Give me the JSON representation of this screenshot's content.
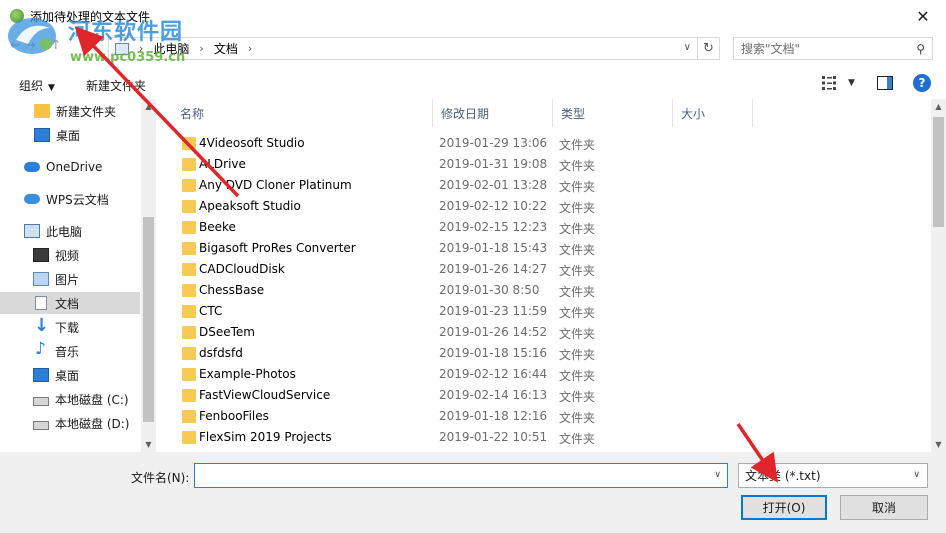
{
  "window": {
    "title": "添加待处理的文本文件",
    "close_glyph": "✕"
  },
  "watermark": {
    "title": "河东软件园",
    "url": "www.pc0359.cn"
  },
  "address": {
    "crumbs": [
      "此电脑",
      "文档"
    ],
    "separator": "›"
  },
  "search": {
    "placeholder": "搜索\"文档\""
  },
  "toolbar": {
    "organize_label": "组织",
    "new_folder_label": "新建文件夹",
    "help_glyph": "?"
  },
  "nav_pane": {
    "items": [
      {
        "label": "新建文件夹",
        "icon": "folder-icon"
      },
      {
        "label": "桌面",
        "icon": "desktop-icon"
      },
      {
        "label": "OneDrive",
        "icon": "onedrive-icon"
      },
      {
        "label": "WPS云文档",
        "icon": "wps-cloud-icon"
      },
      {
        "label": "此电脑",
        "icon": "pc-icon"
      },
      {
        "label": "视频",
        "icon": "video-icon"
      },
      {
        "label": "图片",
        "icon": "picture-icon"
      },
      {
        "label": "文档",
        "icon": "document-icon",
        "selected": true
      },
      {
        "label": "下载",
        "icon": "download-icon"
      },
      {
        "label": "音乐",
        "icon": "music-icon"
      },
      {
        "label": "桌面",
        "icon": "desktop-icon"
      },
      {
        "label": "本地磁盘 (C:)",
        "icon": "disk-icon"
      },
      {
        "label": "本地磁盘 (D:)",
        "icon": "disk-icon"
      }
    ]
  },
  "columns": {
    "name": "名称",
    "date": "修改日期",
    "type": "类型",
    "size": "大小"
  },
  "files": [
    {
      "name": "4Videosoft Studio",
      "date": "2019-01-29 13:06",
      "type": "文件夹"
    },
    {
      "name": "ALDrive",
      "date": "2019-01-31 19:08",
      "type": "文件夹"
    },
    {
      "name": "Any DVD Cloner Platinum",
      "date": "2019-02-01 13:28",
      "type": "文件夹"
    },
    {
      "name": "Apeaksoft Studio",
      "date": "2019-02-12 10:22",
      "type": "文件夹"
    },
    {
      "name": "Beeke",
      "date": "2019-02-15 12:23",
      "type": "文件夹"
    },
    {
      "name": "Bigasoft ProRes Converter",
      "date": "2019-01-18 15:43",
      "type": "文件夹"
    },
    {
      "name": "CADCloudDisk",
      "date": "2019-01-26 14:27",
      "type": "文件夹"
    },
    {
      "name": "ChessBase",
      "date": "2019-01-30 8:50",
      "type": "文件夹"
    },
    {
      "name": "CTC",
      "date": "2019-01-23 11:59",
      "type": "文件夹"
    },
    {
      "name": "DSeeTem",
      "date": "2019-01-26 14:52",
      "type": "文件夹"
    },
    {
      "name": "dsfdsfd",
      "date": "2019-01-18 15:16",
      "type": "文件夹"
    },
    {
      "name": "Example-Photos",
      "date": "2019-02-12 16:44",
      "type": "文件夹"
    },
    {
      "name": "FastViewCloudService",
      "date": "2019-02-14 16:13",
      "type": "文件夹"
    },
    {
      "name": "FenbooFiles",
      "date": "2019-01-18 12:16",
      "type": "文件夹"
    },
    {
      "name": "FlexSim 2019 Projects",
      "date": "2019-01-22 10:51",
      "type": "文件夹"
    }
  ],
  "bottom": {
    "filename_label": "文件名(N):",
    "filename_value": "",
    "filter_value": "文本类 (*.txt)",
    "open_label": "打开(O)",
    "cancel_label": "取消"
  },
  "colors": {
    "accent": "#0078d7",
    "folder": "#f7c955",
    "annotation_arrow": "#e0262b"
  }
}
